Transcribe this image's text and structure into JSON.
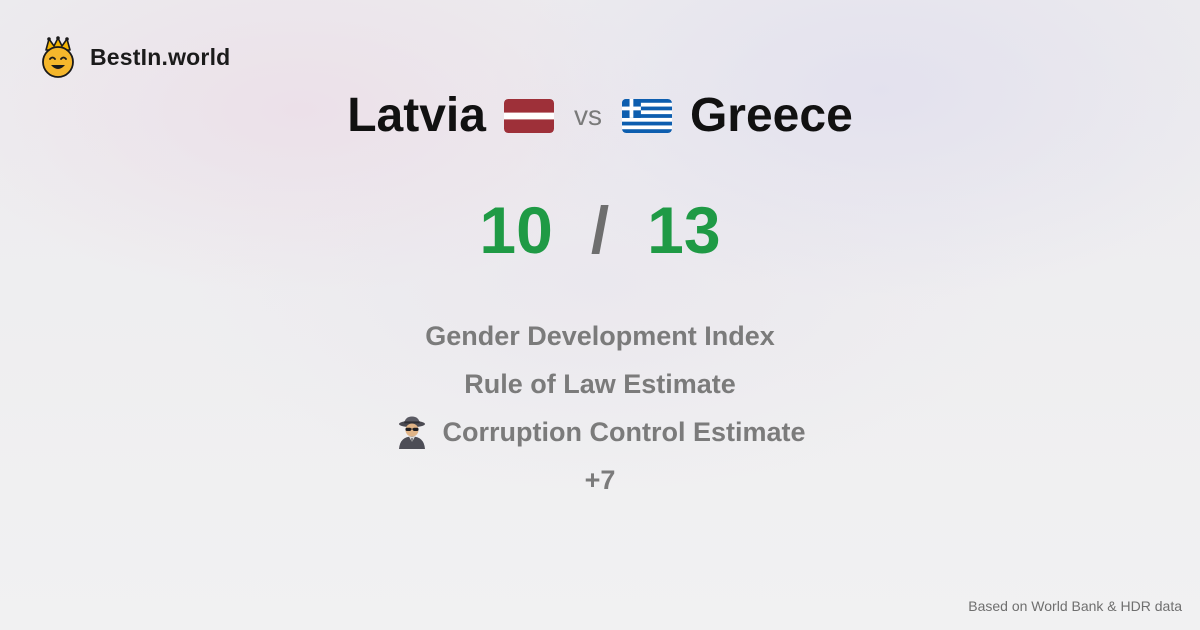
{
  "brand": {
    "name": "BestIn.world",
    "logo_icon": "crown-smiley-icon"
  },
  "comparison": {
    "left": {
      "name": "Latvia",
      "flag_icon": "latvia-flag-icon",
      "flag_colors": [
        "#9e3039",
        "#ffffff"
      ]
    },
    "vs_label": "vs",
    "right": {
      "name": "Greece",
      "flag_icon": "greece-flag-icon",
      "flag_colors": [
        "#0d5eaf",
        "#ffffff"
      ]
    }
  },
  "score": {
    "left": "10",
    "separator": "/",
    "right": "13",
    "color": "#1f9a45"
  },
  "metrics": [
    {
      "label": "Gender Development Index",
      "icon": ""
    },
    {
      "label": "Rule of Law Estimate",
      "icon": ""
    },
    {
      "label": "Corruption Control Estimate",
      "icon": "detective-icon"
    },
    {
      "label": "+7",
      "icon": ""
    }
  ],
  "footer": {
    "source": "Based on World Bank & HDR data"
  }
}
